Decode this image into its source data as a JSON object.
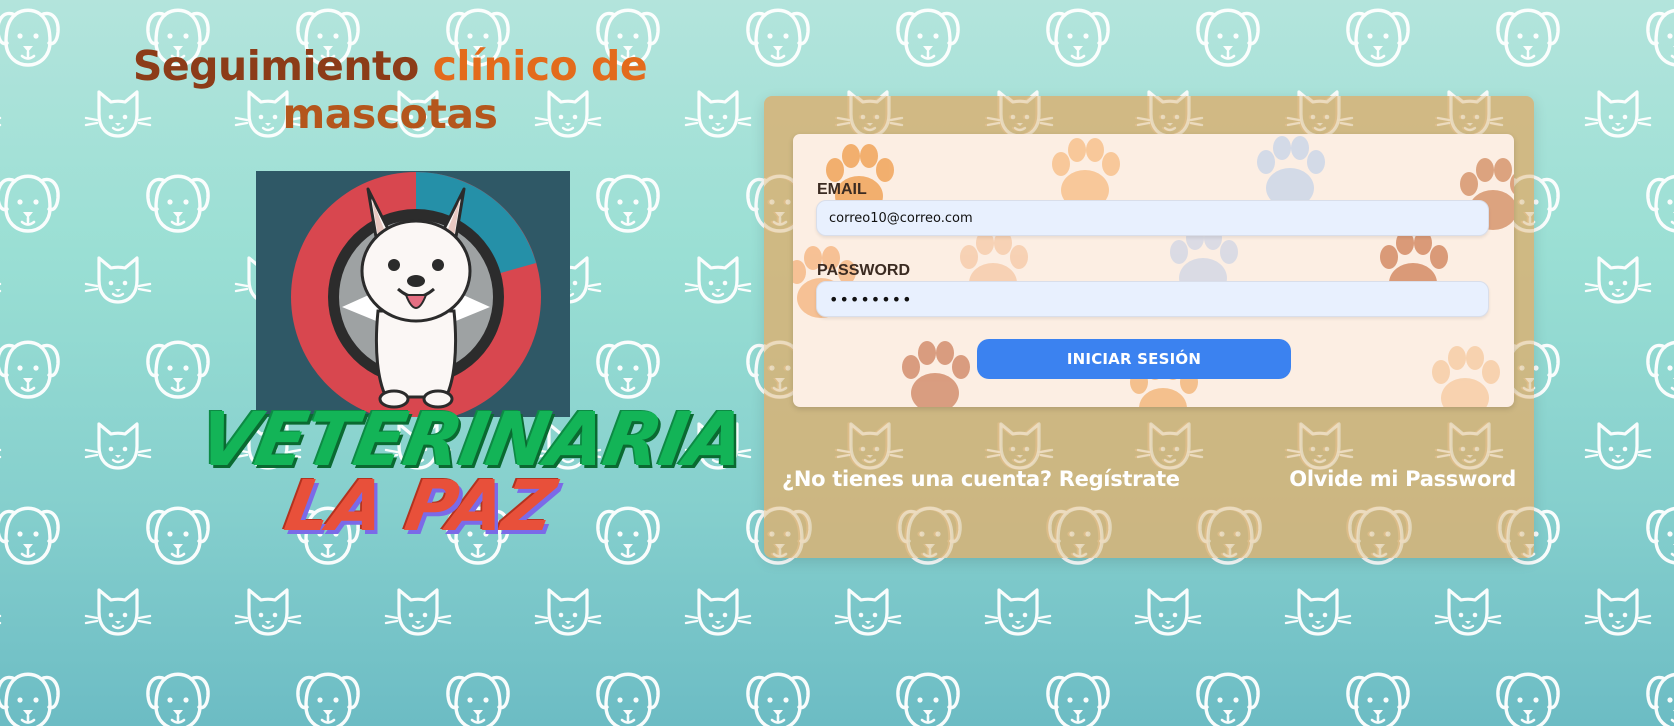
{
  "header": {
    "title_part1": "Seguimiento ",
    "title_part2": "clínico de",
    "title_part3": "mascotas"
  },
  "brand": {
    "line1": "VETERINARIA",
    "line2": "LA PAZ",
    "logo_icon": "dog-logo-icon"
  },
  "login_form": {
    "email_label": "EMAIL",
    "email_value": "correo10@correo.com",
    "password_label": "PASSWORD",
    "password_value": "••••••••",
    "submit_label": "INICIAR SESIÓN"
  },
  "links": {
    "register": "¿No tienes una cuenta? Regístrate",
    "forgot": "Olvide mi Password"
  },
  "colors": {
    "submit_button": "#3b82f0",
    "panel_background": "#d7b276",
    "brand_green": "#13b457",
    "brand_red": "#e8503a",
    "title_brown": "#8c3c18",
    "title_orange": "#e36b1c"
  }
}
